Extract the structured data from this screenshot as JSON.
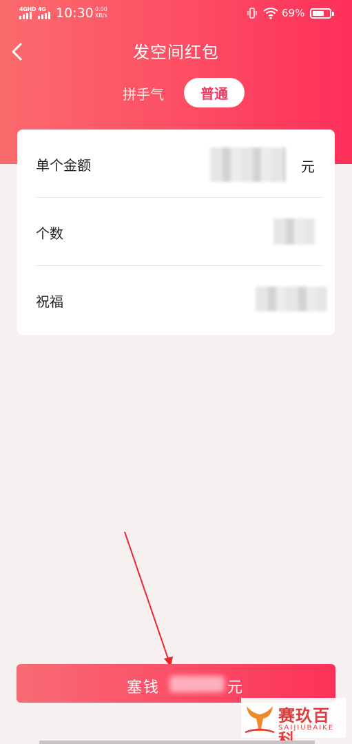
{
  "status_bar": {
    "sim1_label": "4GHD",
    "sim2_label": "4G",
    "time": "10:30",
    "speed_value": "0.00",
    "speed_unit": "KB/s",
    "battery_percent": "69%",
    "battery_level": 0.69,
    "icons": [
      "signal-icon",
      "vibrate-icon",
      "wifi-icon",
      "battery-icon"
    ]
  },
  "header": {
    "back_icon": "chevron-left-icon",
    "title": "发空间红包",
    "tabs": [
      {
        "label": "拼手气",
        "selected": false
      },
      {
        "label": "普通",
        "selected": true
      }
    ]
  },
  "form": {
    "rows": [
      {
        "label": "单个金额",
        "value": "",
        "unit": "元"
      },
      {
        "label": "个数",
        "value": ""
      },
      {
        "label": "祝福",
        "value": ""
      }
    ]
  },
  "submit": {
    "label_prefix": "塞钱",
    "label_suffix": "元"
  },
  "watermark": {
    "title": "赛玖百科",
    "subtitle": "SAIJIUBAIKE"
  },
  "colors": {
    "header_gradient_start": "#fb6b6d",
    "header_gradient_end": "#fe2f5a",
    "accent_text": "#f23a60",
    "page_background": "#f6f0f1",
    "annotation_arrow": "#e8262e"
  }
}
